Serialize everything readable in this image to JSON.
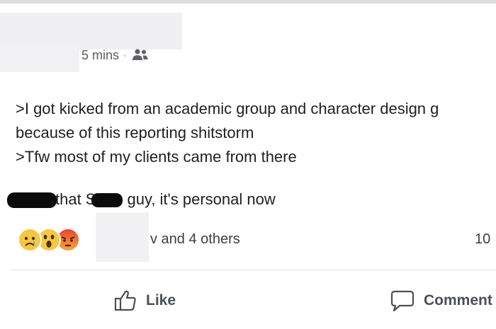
{
  "post": {
    "timestamp": "5 mins",
    "separator": "·",
    "privacy_icon": "friends-icon",
    "lines": [
      ">I got kicked from an academic group and character design g",
      "because of this reporting shitstorm",
      ">Tfw most of my clients came from there"
    ],
    "line4_part1": "that S",
    "line4_part2": "guy, it's personal now"
  },
  "reactions": {
    "icons": [
      "sad-emoji-icon",
      "wow-emoji-icon",
      "angry-emoji-icon"
    ],
    "likers_text": "v and 4 others",
    "count_text": "10"
  },
  "actions": {
    "like_label": "Like",
    "comment_label": "Comment"
  },
  "colors": {
    "text": "#1e1f22",
    "meta": "#5a5d62",
    "action": "#4b4f56",
    "divider": "#dddfe2"
  }
}
